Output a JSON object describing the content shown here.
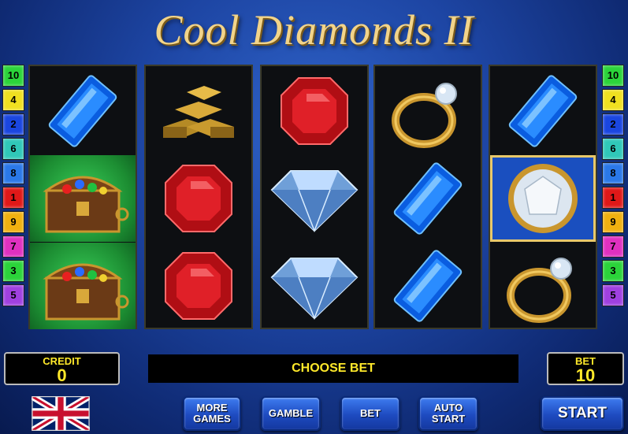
{
  "game": {
    "title": "Cool Diamonds II"
  },
  "lines_left": [
    "10",
    "4",
    "2",
    "6",
    "8",
    "1",
    "9",
    "7",
    "3",
    "5"
  ],
  "lines_right": [
    "10",
    "4",
    "2",
    "6",
    "8",
    "1",
    "9",
    "7",
    "3",
    "5"
  ],
  "line_colors": [
    "#2bd43a",
    "#f0e020",
    "#1a46e0",
    "#30c8b8",
    "#2a78e8",
    "#e01818",
    "#f0b010",
    "#e030c0",
    "#2bd43a",
    "#a040e0"
  ],
  "reels": [
    [
      "blue-gem",
      "treasure-chest",
      "treasure-chest"
    ],
    [
      "gold-bars",
      "red-ruby",
      "red-ruby"
    ],
    [
      "red-ruby",
      "white-diamond",
      "white-diamond"
    ],
    [
      "gold-ring",
      "blue-gem",
      "blue-gem"
    ],
    [
      "blue-gem",
      "white-diamond-medallion",
      "gold-ring"
    ]
  ],
  "credit": {
    "label": "CREDIT",
    "value": "0"
  },
  "bet": {
    "label": "BET",
    "value": "10"
  },
  "message": "CHOOSE BET",
  "buttons": {
    "more_games": "MORE GAMES",
    "gamble": "GAMBLE",
    "bet": "BET",
    "auto_start": "AUTO START",
    "start": "START"
  },
  "language_icon": "uk-flag-icon"
}
